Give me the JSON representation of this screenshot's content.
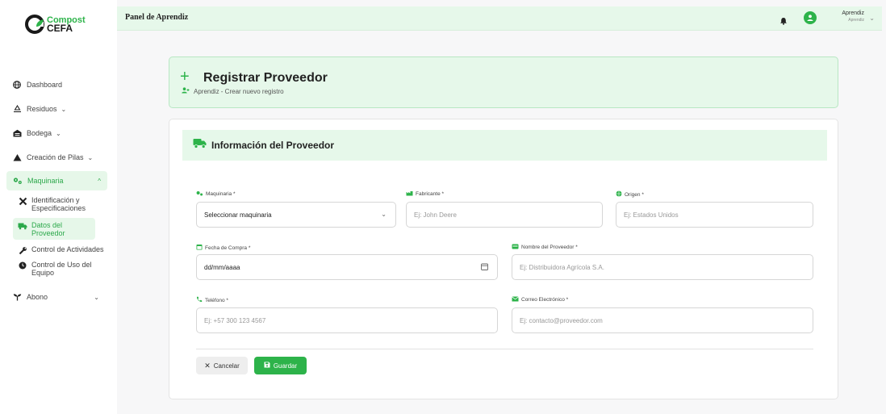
{
  "brand": {
    "line1": "Compost",
    "line2": "CEFA"
  },
  "header": {
    "title": "Panel de Aprendiz",
    "user_name": "Aprendiz",
    "user_role": "Aprendiz"
  },
  "sidebar": {
    "items": [
      {
        "label": "Dashboard",
        "icon": "globe-icon"
      },
      {
        "label": "Residuos",
        "icon": "recycle-icon"
      },
      {
        "label": "Bodega",
        "icon": "warehouse-icon"
      },
      {
        "label": "Creación de Pilas",
        "icon": "mountain-icon"
      },
      {
        "label": "Maquinaria",
        "icon": "gears-icon"
      },
      {
        "label": "Abono",
        "icon": "seedling-icon"
      }
    ],
    "subitems": [
      {
        "label": "Identificación y Especificaciones",
        "icon": "tools-icon"
      },
      {
        "label": "Datos del Proveedor",
        "icon": "truck-icon"
      },
      {
        "label": "Control de Actividades",
        "icon": "wrench-icon"
      },
      {
        "label": "Control de Uso del Equipo",
        "icon": "clock-icon"
      }
    ]
  },
  "page": {
    "title": "Registrar Proveedor",
    "subtitle": "Aprendiz - Crear nuevo registro"
  },
  "section": {
    "title": "Información del Proveedor"
  },
  "form": {
    "maquinaria": {
      "label": "Maquinaria *",
      "value": "Seleccionar maquinaria"
    },
    "fabricante": {
      "label": "Fabricante *",
      "placeholder": "Ej: John Deere"
    },
    "origen": {
      "label": "Origen *",
      "placeholder": "Ej: Estados Unidos"
    },
    "fecha": {
      "label": "Fecha de Compra *",
      "value": "dd/mm/aaaa"
    },
    "proveedor": {
      "label": "Nombre del Proveedor *",
      "placeholder": "Ej: Distribuidora Agrícola S.A."
    },
    "telefono": {
      "label": "Teléfono *",
      "placeholder": "Ej: +57 300 123 4567"
    },
    "correo": {
      "label": "Correo Electrónico *",
      "placeholder": "Ej: contacto@proveedor.com"
    }
  },
  "buttons": {
    "cancel": "Cancelar",
    "save": "Guardar"
  },
  "colors": {
    "accent": "#2db34a",
    "accent_light": "#e6f8ea"
  }
}
